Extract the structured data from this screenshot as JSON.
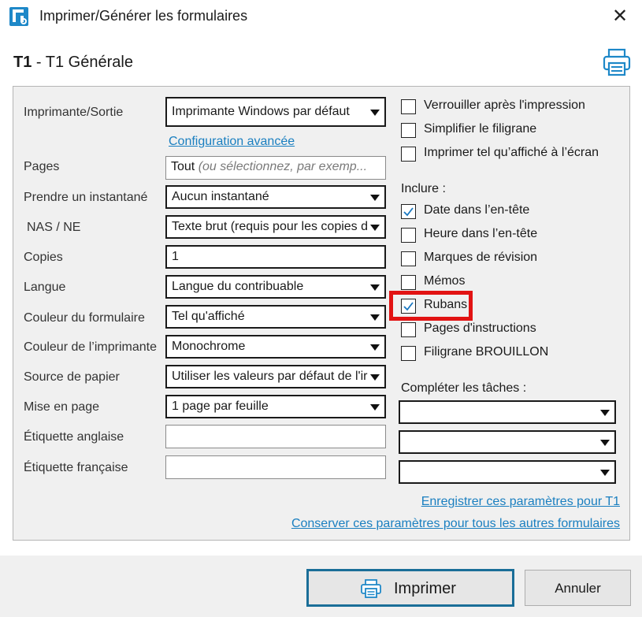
{
  "window": {
    "title": "Imprimer/Générer les formulaires",
    "close_symbol": "✕"
  },
  "header": {
    "form_code": "T1",
    "separator": " - ",
    "form_name": "T1 Générale",
    "printer_icon": "printer-icon"
  },
  "fields": {
    "printer": {
      "label": "Imprimante/Sortie",
      "value": "Imprimante Windows par défaut"
    },
    "advanced_link": "Configuration avancée",
    "pages": {
      "label": "Pages",
      "value": "Tout",
      "hint": "(ou sélectionnez, par exemp..."
    },
    "snapshot": {
      "label": "Prendre un instantané",
      "value": "Aucun instantané"
    },
    "sin": {
      "label": "NAS / NE",
      "value": "Texte brut (requis pour les copies d"
    },
    "copies": {
      "label": "Copies",
      "value": "1"
    },
    "language": {
      "label": "Langue",
      "value": "Langue du contribuable"
    },
    "form_color": {
      "label": "Couleur du formulaire",
      "value": "Tel qu'affiché"
    },
    "printer_color": {
      "label": "Couleur de l’imprimante",
      "value": "Monochrome"
    },
    "paper_source": {
      "label": "Source de papier",
      "value": "Utiliser les valeurs par défaut de l'ir"
    },
    "layout": {
      "label": "Mise en page",
      "value": "1 page par feuille"
    },
    "english_label": {
      "label": "Étiquette anglaise",
      "value": ""
    },
    "french_label": {
      "label": "Étiquette française",
      "value": ""
    }
  },
  "options": {
    "lock_after_print": {
      "label": "Verrouiller après l'impression",
      "checked": false
    },
    "simplify_watermark": {
      "label": "Simplifier le filigrane",
      "checked": false
    },
    "print_as_displayed": {
      "label": "Imprimer tel qu’affiché à l’écran",
      "checked": false
    }
  },
  "include": {
    "heading": "Inclure :",
    "items": [
      {
        "label": "Date dans l’en-tête",
        "checked": true
      },
      {
        "label": "Heure dans l’en-tête",
        "checked": false
      },
      {
        "label": "Marques de révision",
        "checked": false
      },
      {
        "label": "Mémos",
        "checked": false
      },
      {
        "label": "Rubans",
        "checked": true
      },
      {
        "label": "Pages d'instructions",
        "checked": false
      },
      {
        "label": "Filigrane BROUILLON",
        "checked": false
      }
    ]
  },
  "tasks": {
    "heading": "Compléter les tâches :",
    "selects": [
      "",
      "",
      ""
    ]
  },
  "links": {
    "save_for_form": "Enregistrer ces paramètres pour T1",
    "keep_for_all": "Conserver ces paramètres pour tous les autres formulaires"
  },
  "buttons": {
    "print": "Imprimer",
    "cancel": "Annuler"
  },
  "colors": {
    "accent_blue": "#1a6e98",
    "link_blue": "#1a7fc0",
    "checkmark_blue": "#1a78c2",
    "highlight_red": "#e21313"
  }
}
